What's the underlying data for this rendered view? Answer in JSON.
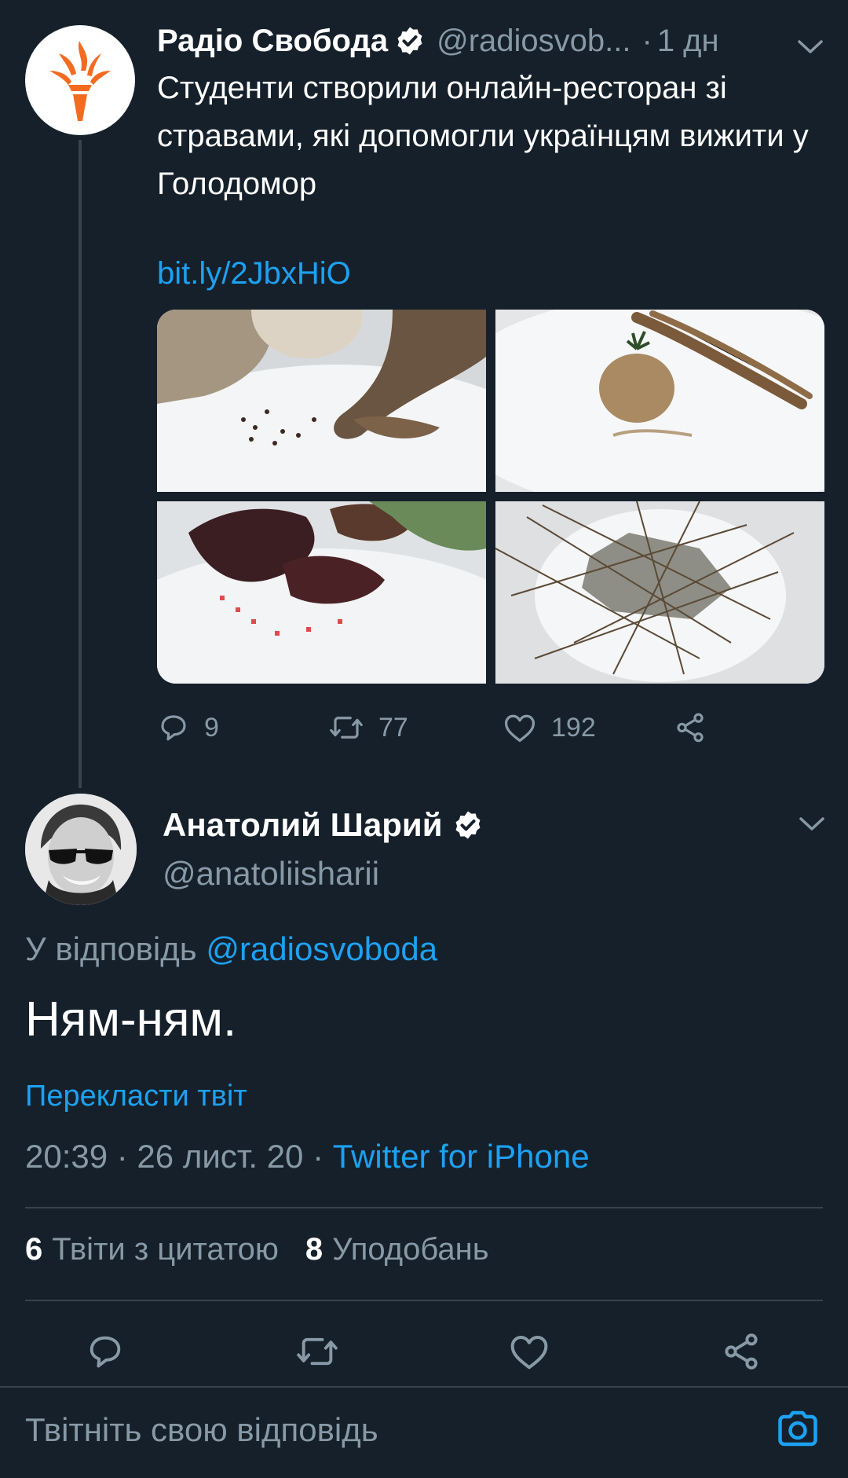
{
  "parent_tweet": {
    "author_name": "Радіо Свобода",
    "author_handle": "@radiosvob...",
    "separator": "·",
    "time": "1 дн",
    "text": "Студенти створили онлайн-ресторан зі стравами, які допомогли українцям вижити у Голодомор",
    "link": "bit.ly/2JbxHiO",
    "media": [
      {
        "caption": "food-photo-bread-mushroom"
      },
      {
        "caption": "food-photo-cutlet-spruce"
      },
      {
        "caption": "food-photo-beet"
      },
      {
        "caption": "food-photo-grass-cake"
      }
    ],
    "replies": "9",
    "retweets": "77",
    "likes": "192"
  },
  "main_tweet": {
    "author_name": "Анатолий Шарий",
    "author_handle": "@anatoliisharii",
    "reply_prefix": "У відповідь",
    "reply_handle": "@radiosvoboda",
    "text": "Ням-ням.",
    "translate": "Перекласти твіт",
    "time": "20:39 · 26 лист. 20 · ",
    "source": "Twitter for iPhone",
    "quote_count": "6",
    "quote_label": "Твіти з цитатою",
    "likes_count": "8",
    "likes_label": "Уподобань"
  },
  "reply_bar": {
    "placeholder": "Твітніть свою відповідь"
  },
  "colors": {
    "background": "#15202b",
    "accent": "#1da1f2",
    "muted": "#8899a6",
    "divider": "#38444d",
    "logo_orange": "#f26b21"
  }
}
